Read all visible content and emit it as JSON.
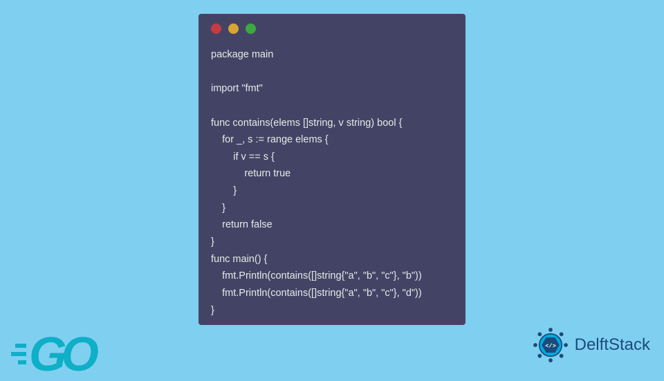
{
  "code": {
    "lines": [
      "package main",
      "",
      "import \"fmt\"",
      "",
      "func contains(elems []string, v string) bool {",
      "    for _, s := range elems {",
      "        if v == s {",
      "            return true",
      "        }",
      "    }",
      "    return false",
      "}",
      "func main() {",
      "    fmt.Println(contains([]string{\"a\", \"b\", \"c\"}, \"b\"))",
      "    fmt.Println(contains([]string{\"a\", \"b\", \"c\"}, \"d\"))",
      "}"
    ]
  },
  "logos": {
    "go": "GO",
    "delftstack": "DelftStack"
  }
}
